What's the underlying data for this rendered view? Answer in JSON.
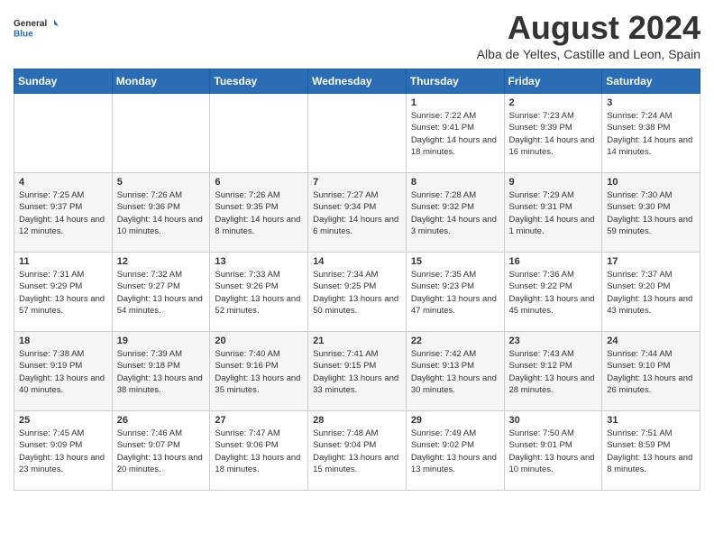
{
  "logo": {
    "general": "General",
    "blue": "Blue"
  },
  "title": "August 2024",
  "subtitle": "Alba de Yeltes, Castille and Leon, Spain",
  "days_of_week": [
    "Sunday",
    "Monday",
    "Tuesday",
    "Wednesday",
    "Thursday",
    "Friday",
    "Saturday"
  ],
  "weeks": [
    [
      {
        "day": "",
        "info": ""
      },
      {
        "day": "",
        "info": ""
      },
      {
        "day": "",
        "info": ""
      },
      {
        "day": "",
        "info": ""
      },
      {
        "day": "1",
        "info": "Sunrise: 7:22 AM\nSunset: 9:41 PM\nDaylight: 14 hours and 18 minutes."
      },
      {
        "day": "2",
        "info": "Sunrise: 7:23 AM\nSunset: 9:39 PM\nDaylight: 14 hours and 16 minutes."
      },
      {
        "day": "3",
        "info": "Sunrise: 7:24 AM\nSunset: 9:38 PM\nDaylight: 14 hours and 14 minutes."
      }
    ],
    [
      {
        "day": "4",
        "info": "Sunrise: 7:25 AM\nSunset: 9:37 PM\nDaylight: 14 hours and 12 minutes."
      },
      {
        "day": "5",
        "info": "Sunrise: 7:26 AM\nSunset: 9:36 PM\nDaylight: 14 hours and 10 minutes."
      },
      {
        "day": "6",
        "info": "Sunrise: 7:26 AM\nSunset: 9:35 PM\nDaylight: 14 hours and 8 minutes."
      },
      {
        "day": "7",
        "info": "Sunrise: 7:27 AM\nSunset: 9:34 PM\nDaylight: 14 hours and 6 minutes."
      },
      {
        "day": "8",
        "info": "Sunrise: 7:28 AM\nSunset: 9:32 PM\nDaylight: 14 hours and 3 minutes."
      },
      {
        "day": "9",
        "info": "Sunrise: 7:29 AM\nSunset: 9:31 PM\nDaylight: 14 hours and 1 minute."
      },
      {
        "day": "10",
        "info": "Sunrise: 7:30 AM\nSunset: 9:30 PM\nDaylight: 13 hours and 59 minutes."
      }
    ],
    [
      {
        "day": "11",
        "info": "Sunrise: 7:31 AM\nSunset: 9:29 PM\nDaylight: 13 hours and 57 minutes."
      },
      {
        "day": "12",
        "info": "Sunrise: 7:32 AM\nSunset: 9:27 PM\nDaylight: 13 hours and 54 minutes."
      },
      {
        "day": "13",
        "info": "Sunrise: 7:33 AM\nSunset: 9:26 PM\nDaylight: 13 hours and 52 minutes."
      },
      {
        "day": "14",
        "info": "Sunrise: 7:34 AM\nSunset: 9:25 PM\nDaylight: 13 hours and 50 minutes."
      },
      {
        "day": "15",
        "info": "Sunrise: 7:35 AM\nSunset: 9:23 PM\nDaylight: 13 hours and 47 minutes."
      },
      {
        "day": "16",
        "info": "Sunrise: 7:36 AM\nSunset: 9:22 PM\nDaylight: 13 hours and 45 minutes."
      },
      {
        "day": "17",
        "info": "Sunrise: 7:37 AM\nSunset: 9:20 PM\nDaylight: 13 hours and 43 minutes."
      }
    ],
    [
      {
        "day": "18",
        "info": "Sunrise: 7:38 AM\nSunset: 9:19 PM\nDaylight: 13 hours and 40 minutes."
      },
      {
        "day": "19",
        "info": "Sunrise: 7:39 AM\nSunset: 9:18 PM\nDaylight: 13 hours and 38 minutes."
      },
      {
        "day": "20",
        "info": "Sunrise: 7:40 AM\nSunset: 9:16 PM\nDaylight: 13 hours and 35 minutes."
      },
      {
        "day": "21",
        "info": "Sunrise: 7:41 AM\nSunset: 9:15 PM\nDaylight: 13 hours and 33 minutes."
      },
      {
        "day": "22",
        "info": "Sunrise: 7:42 AM\nSunset: 9:13 PM\nDaylight: 13 hours and 30 minutes."
      },
      {
        "day": "23",
        "info": "Sunrise: 7:43 AM\nSunset: 9:12 PM\nDaylight: 13 hours and 28 minutes."
      },
      {
        "day": "24",
        "info": "Sunrise: 7:44 AM\nSunset: 9:10 PM\nDaylight: 13 hours and 26 minutes."
      }
    ],
    [
      {
        "day": "25",
        "info": "Sunrise: 7:45 AM\nSunset: 9:09 PM\nDaylight: 13 hours and 23 minutes."
      },
      {
        "day": "26",
        "info": "Sunrise: 7:46 AM\nSunset: 9:07 PM\nDaylight: 13 hours and 20 minutes."
      },
      {
        "day": "27",
        "info": "Sunrise: 7:47 AM\nSunset: 9:06 PM\nDaylight: 13 hours and 18 minutes."
      },
      {
        "day": "28",
        "info": "Sunrise: 7:48 AM\nSunset: 9:04 PM\nDaylight: 13 hours and 15 minutes."
      },
      {
        "day": "29",
        "info": "Sunrise: 7:49 AM\nSunset: 9:02 PM\nDaylight: 13 hours and 13 minutes."
      },
      {
        "day": "30",
        "info": "Sunrise: 7:50 AM\nSunset: 9:01 PM\nDaylight: 13 hours and 10 minutes."
      },
      {
        "day": "31",
        "info": "Sunrise: 7:51 AM\nSunset: 8:59 PM\nDaylight: 13 hours and 8 minutes."
      }
    ]
  ]
}
